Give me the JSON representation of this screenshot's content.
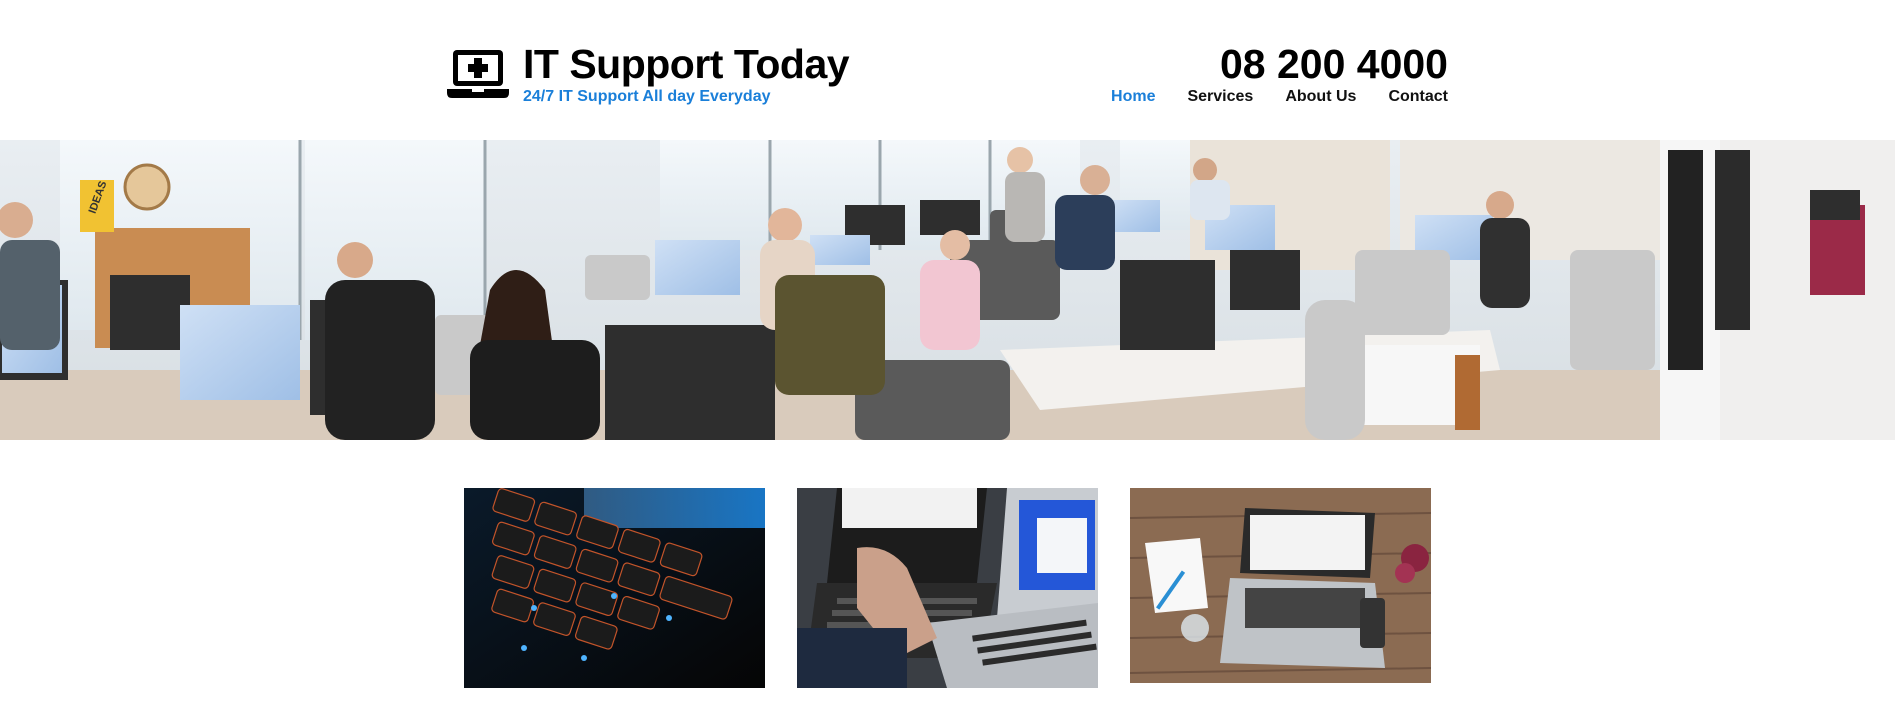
{
  "header": {
    "site_title": "IT Support Today",
    "tagline": "24/7 IT Support All day Everyday",
    "phone": "08 200 4000",
    "logo_icon": "laptop-medical-icon"
  },
  "nav": {
    "items": [
      {
        "label": "Home",
        "active": true
      },
      {
        "label": "Services",
        "active": false
      },
      {
        "label": "About Us",
        "active": false
      },
      {
        "label": "Contact",
        "active": false
      }
    ]
  },
  "hero": {
    "signage_text": "IDEAS"
  },
  "colors": {
    "accent": "#1a7fd9",
    "text": "#111111",
    "background": "#ffffff"
  }
}
